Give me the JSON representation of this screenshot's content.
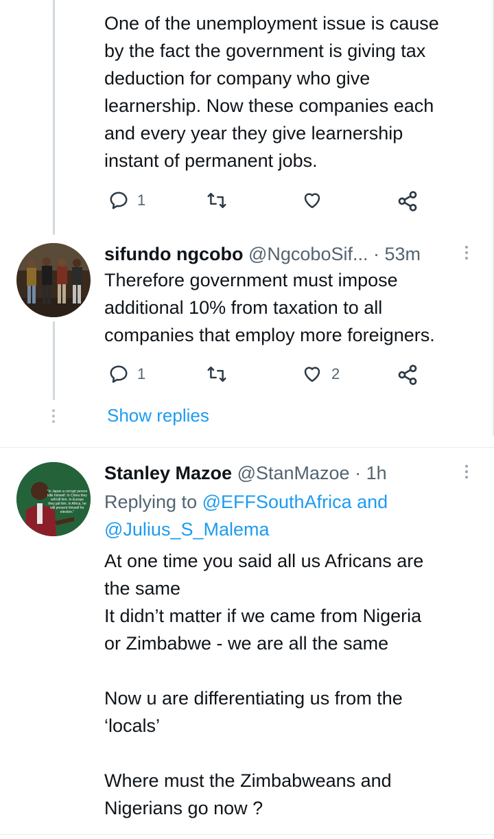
{
  "tweet1": {
    "lines": [
      "One of the unemployment issue is cause",
      "by the fact the government is giving tax",
      "deduction for company who give",
      "learnership. Now these companies each",
      "and every year they give learnership",
      "instant of permanent jobs."
    ],
    "reply_count": "1",
    "retweet_count": "",
    "like_count": ""
  },
  "tweet2": {
    "name": "sifundo ngcobo",
    "handle": "@NgcoboSif...",
    "time": "· 53m",
    "lines": [
      "Therefore government must impose",
      "additional 10% from taxation to all",
      "companies that employ more foreigners."
    ],
    "reply_count": "1",
    "retweet_count": "",
    "like_count": "2"
  },
  "show_replies": "Show replies",
  "tweet3": {
    "name": "Stanley Mazoe",
    "handle": "@StanMazoe",
    "time": "· 1h",
    "replying_label": "Replying to",
    "mention1": "@EFFSouthAfrica",
    "and": "and",
    "mention2": "@Julius_S_Malema",
    "lines": [
      "At one time you said all us Africans are",
      "the same",
      "It didn’t matter if we came from Nigeria",
      "or Zimbabwe - we are all the same",
      "",
      "Now u are differentiating us from the",
      "‘locals’",
      "",
      "Where must the Zimbabweans and",
      "Nigerians go now ?"
    ],
    "avatar_quote": "\"In Japan a corrupt person kills himself. In China they will kill him. In Europe they jail him. In Africa, he will present himself for election.\""
  },
  "colors": {
    "accent": "#1d9bf0",
    "muted": "#536471",
    "text": "#0f1419",
    "line": "#cfd9de"
  }
}
